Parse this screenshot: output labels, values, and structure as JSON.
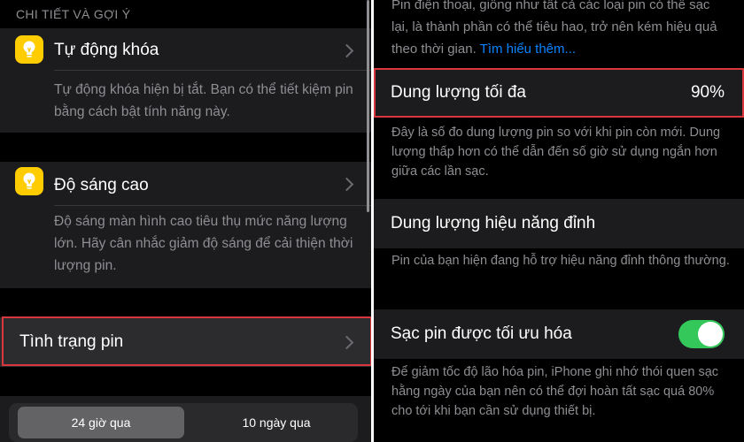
{
  "left": {
    "section_header": "CHI TIẾT VÀ GỢI Ý",
    "auto_lock": {
      "title": "Tự động khóa",
      "description": "Tự động khóa hiện bị tắt. Bạn có thể tiết kiệm pin bằng cách bật tính năng này."
    },
    "high_brightness": {
      "title": "Độ sáng cao",
      "description": "Độ sáng màn hình cao tiêu thụ mức năng lượng lớn. Hãy cân nhắc giảm độ sáng để cải thiện thời lượng pin."
    },
    "battery_health": {
      "title": "Tình trạng pin"
    },
    "segmented": {
      "option_1": "24 giờ qua",
      "option_2": "10 ngày qua",
      "selected": "24 giờ qua"
    }
  },
  "right": {
    "intro_text": "Pin điện thoại, giống như tất cả các loại pin có thể sạc lại, là thành phần có thể tiêu hao, trở nên kém hiệu quả theo thời gian.",
    "learn_more": "Tìm hiểu thêm...",
    "max_capacity": {
      "title": "Dung lượng tối đa",
      "value": "90%",
      "description": "Đây là số đo dung lượng pin so với khi pin còn mới. Dung lượng thấp hơn có thể dẫn đến số giờ sử dụng ngắn hơn giữa các lần sạc."
    },
    "peak_performance": {
      "title": "Dung lượng hiệu năng đỉnh",
      "description": "Pin của bạn hiện đang hỗ trợ hiệu năng đỉnh thông thường."
    },
    "optimized_charging": {
      "title": "Sạc pin được tối ưu hóa",
      "enabled": true,
      "description": "Để giảm tốc độ lão hóa pin, iPhone ghi nhớ thói quen sạc hằng ngày của bạn nên có thể đợi hoàn tất sạc quá 80% cho tới khi bạn cần sử dụng thiết bị."
    }
  },
  "colors": {
    "highlight": "#d9363e",
    "toggle_on": "#34c759",
    "link": "#0a84ff",
    "icon_bg": "#ffcc00"
  },
  "icons": {
    "auto_lock": "lightbulb-icon",
    "brightness": "lightbulb-icon"
  }
}
